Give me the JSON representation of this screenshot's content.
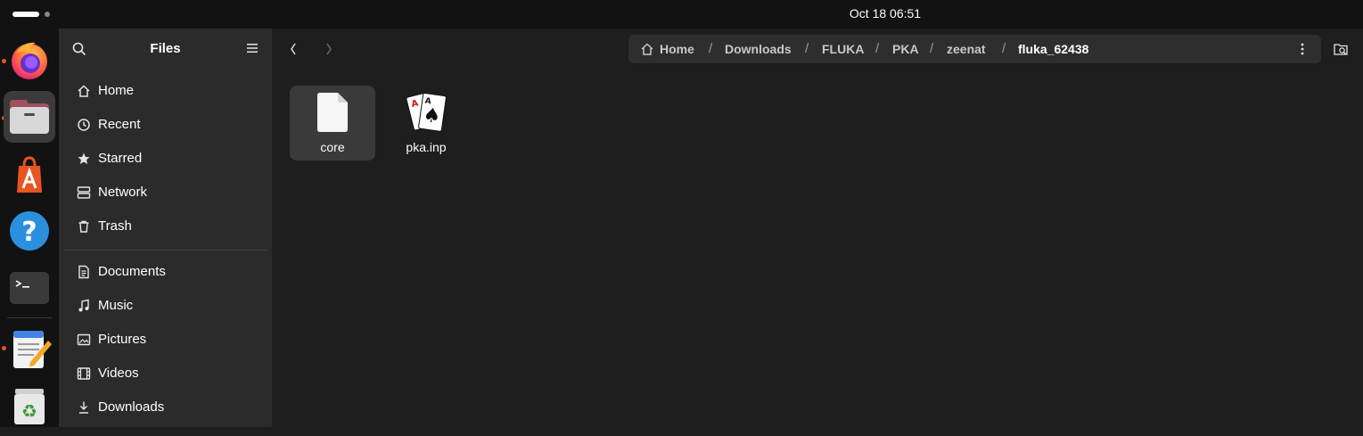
{
  "topbar": {
    "clock": "Oct 18  06:51"
  },
  "dock": {
    "items": [
      {
        "name": "Firefox",
        "icon": "firefox-icon"
      },
      {
        "name": "Files",
        "icon": "files-icon"
      },
      {
        "name": "App Center",
        "icon": "app-center-icon"
      },
      {
        "name": "Help",
        "icon": "help-icon"
      },
      {
        "name": "Terminal",
        "icon": "terminal-icon"
      },
      {
        "name": "Text Editor",
        "icon": "text-editor-icon"
      },
      {
        "name": "Trash",
        "icon": "trash-icon"
      }
    ],
    "accent": "#e95420"
  },
  "sidebar": {
    "title": "Files",
    "places": [
      {
        "label": "Home",
        "icon": "home-icon"
      },
      {
        "label": "Recent",
        "icon": "clock-icon"
      },
      {
        "label": "Starred",
        "icon": "star-icon"
      },
      {
        "label": "Network",
        "icon": "network-icon"
      },
      {
        "label": "Trash",
        "icon": "trash-icon"
      }
    ],
    "bookmarks": [
      {
        "label": "Documents",
        "icon": "document-icon"
      },
      {
        "label": "Music",
        "icon": "music-icon"
      },
      {
        "label": "Pictures",
        "icon": "picture-icon"
      },
      {
        "label": "Videos",
        "icon": "video-icon"
      },
      {
        "label": "Downloads",
        "icon": "download-icon"
      }
    ]
  },
  "pathbar": {
    "crumbs": [
      "Home",
      "Downloads",
      "FLUKA",
      "PKA",
      "zeenat",
      "fluka_62438"
    ],
    "separator": "/"
  },
  "files": [
    {
      "name": "core",
      "icon": "blank-file-icon",
      "selected": true
    },
    {
      "name": "pka.inp",
      "icon": "playing-cards-icon",
      "selected": false
    }
  ]
}
